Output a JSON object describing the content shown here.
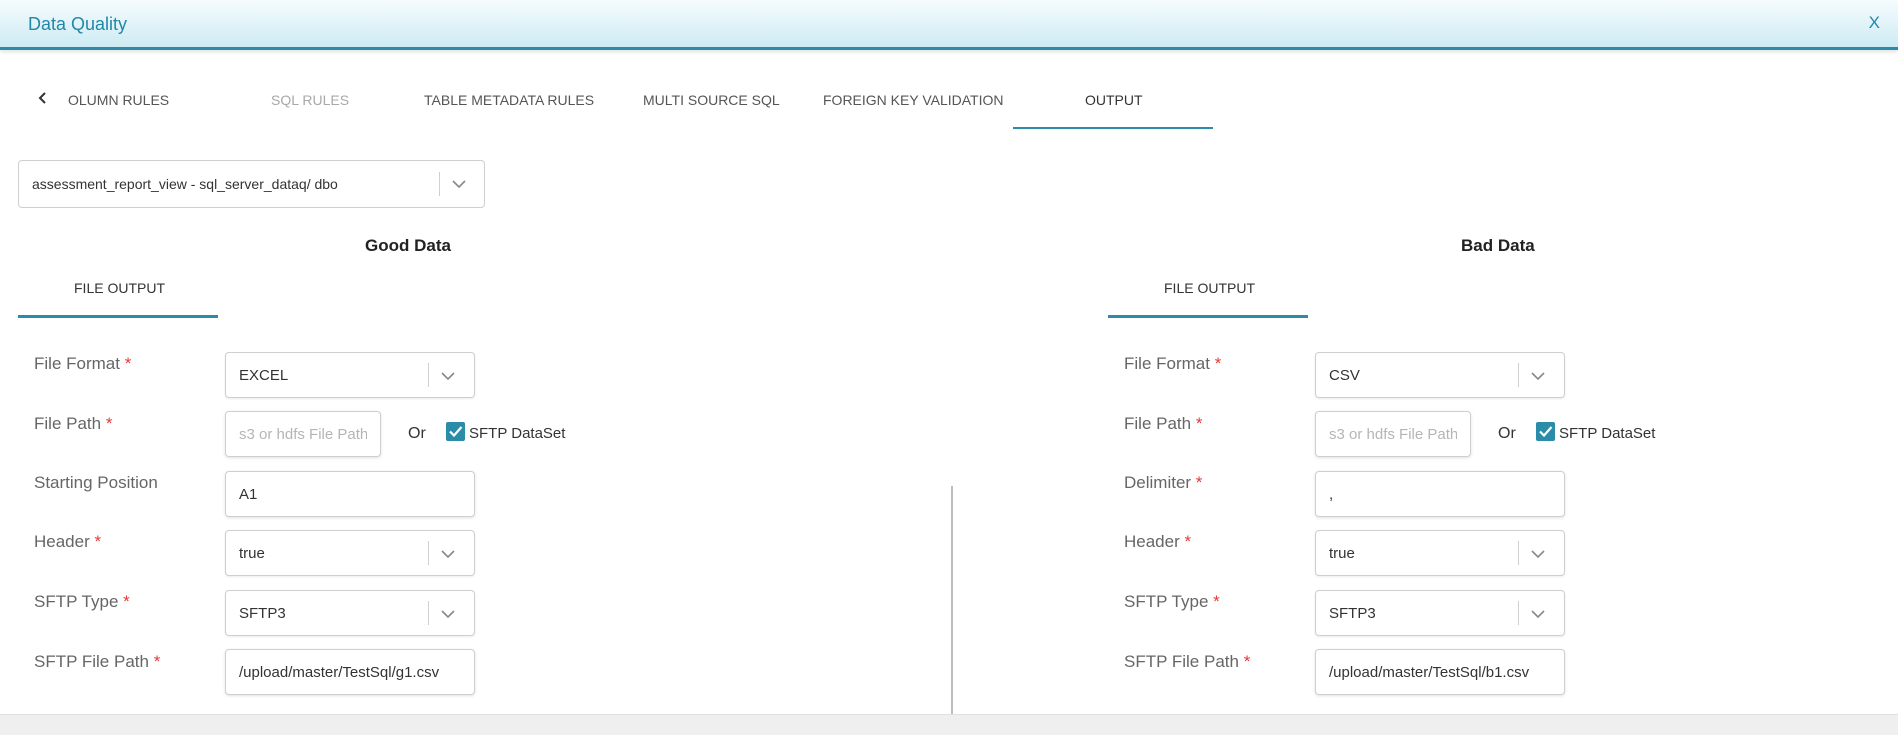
{
  "window": {
    "title": "Data Quality",
    "close_label": "X"
  },
  "tabs": {
    "scroll_left_icon": "chevron-left-icon",
    "items": [
      {
        "label": "OLUMN RULES",
        "state": "normal"
      },
      {
        "label": "SQL RULES",
        "state": "disabled"
      },
      {
        "label": "TABLE METADATA RULES",
        "state": "normal"
      },
      {
        "label": "MULTI SOURCE SQL",
        "state": "normal"
      },
      {
        "label": "FOREIGN KEY VALIDATION",
        "state": "normal"
      },
      {
        "label": "OUTPUT",
        "state": "active"
      }
    ],
    "accent_color": "#2a8ca9"
  },
  "dataset": {
    "selected": "assessment_report_view - sql_server_dataq/ dbo"
  },
  "or_label": "Or",
  "required_mark": "*",
  "good_data": {
    "title": "Good Data",
    "subtab": "FILE OUTPUT",
    "fields": {
      "file_format": {
        "label": "File Format",
        "value": "EXCEL"
      },
      "file_path": {
        "label": "File Path",
        "placeholder": "s3 or hdfs File Path"
      },
      "sftp_dataset": {
        "label": "SFTP DataSet",
        "checked": true
      },
      "starting_position": {
        "label": "Starting Position",
        "value": "A1"
      },
      "header": {
        "label": "Header",
        "value": "true"
      },
      "sftp_type": {
        "label": "SFTP Type",
        "value": "SFTP3"
      },
      "sftp_file_path": {
        "label": "SFTP File Path",
        "value": "/upload/master/TestSql/g1.csv"
      }
    }
  },
  "bad_data": {
    "title": "Bad Data",
    "subtab": "FILE OUTPUT",
    "fields": {
      "file_format": {
        "label": "File Format",
        "value": "CSV"
      },
      "file_path": {
        "label": "File Path",
        "placeholder": "s3 or hdfs File Path"
      },
      "sftp_dataset": {
        "label": "SFTP DataSet",
        "checked": true
      },
      "delimiter": {
        "label": "Delimiter",
        "value": ","
      },
      "header": {
        "label": "Header",
        "value": "true"
      },
      "sftp_type": {
        "label": "SFTP Type",
        "value": "SFTP3"
      },
      "sftp_file_path": {
        "label": "SFTP File Path",
        "value": "/upload/master/TestSql/b1.csv"
      }
    }
  }
}
